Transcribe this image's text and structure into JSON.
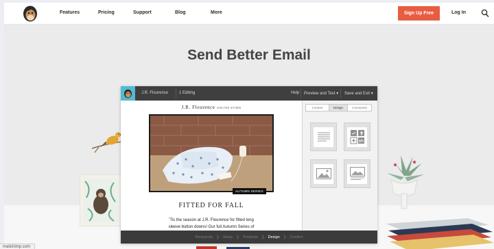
{
  "nav": {
    "links": [
      "Features",
      "Pricing",
      "Support",
      "Blog",
      "More"
    ],
    "signup_label": "Sign Up Free",
    "login_label": "Log In",
    "accent_color": "#e85c41"
  },
  "hero": {
    "headline": "Send Better Email"
  },
  "editor": {
    "toolbar": {
      "campaign_name": "J.R. Flourence",
      "editing_count": "1 Editing",
      "help_label": "Help",
      "preview_label": "Preview and Test ▾",
      "save_label": "Save and Exit ▾"
    },
    "email": {
      "brand_name": "J.R. Flourence",
      "brand_sub": "ONLINE STORE",
      "series_tag": "AUTUMN SERIES",
      "heading": "FITTED FOR FALL",
      "body_line1": "'Tis the season at J.R. Flourence for fitted long",
      "body_line2": "sleeve button downs! Our full Autumn Series of"
    },
    "side_tabs": [
      "Content",
      "Design",
      "Comments"
    ],
    "active_side_tab": "Design",
    "blocks": [
      "text-block",
      "social-block",
      "image-block",
      "image-caption-block"
    ],
    "steps": [
      "Recipients",
      "Setup",
      "Template",
      "Design",
      "Confirm"
    ],
    "active_step": "Design"
  },
  "status_bar": {
    "url": "mailchimp.com"
  }
}
